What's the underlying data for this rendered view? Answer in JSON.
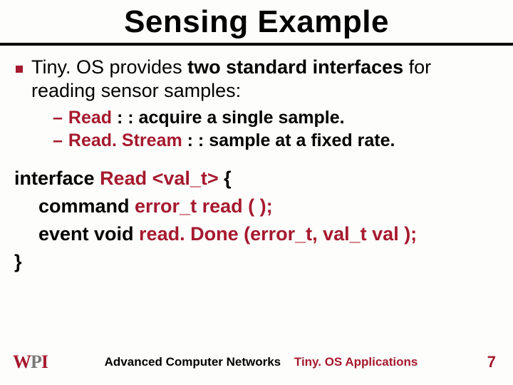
{
  "title": "Sensing Example",
  "bullet": {
    "pre": "Tiny. OS provides ",
    "em": "two standard interfaces",
    "post": " for reading sensor samples:"
  },
  "subs": [
    {
      "name": "Read",
      "desc": " : : acquire a single sample."
    },
    {
      "name": "Read. Stream",
      "desc": " : : sample at a fixed rate."
    }
  ],
  "code": {
    "l1a": "interface ",
    "l1b": "Read <val_t>",
    "l1c": " {",
    "l2a": "command ",
    "l2b": "error_t read ( );",
    "l3a": "event void ",
    "l3b": "read. Done (error_t, val_t val );",
    "l4": "}"
  },
  "footer": {
    "left_w": "W",
    "left_p": "P",
    "left_i": "I",
    "center1": "Advanced Computer Networks",
    "center2": "Tiny. OS Applications",
    "page": "7"
  }
}
